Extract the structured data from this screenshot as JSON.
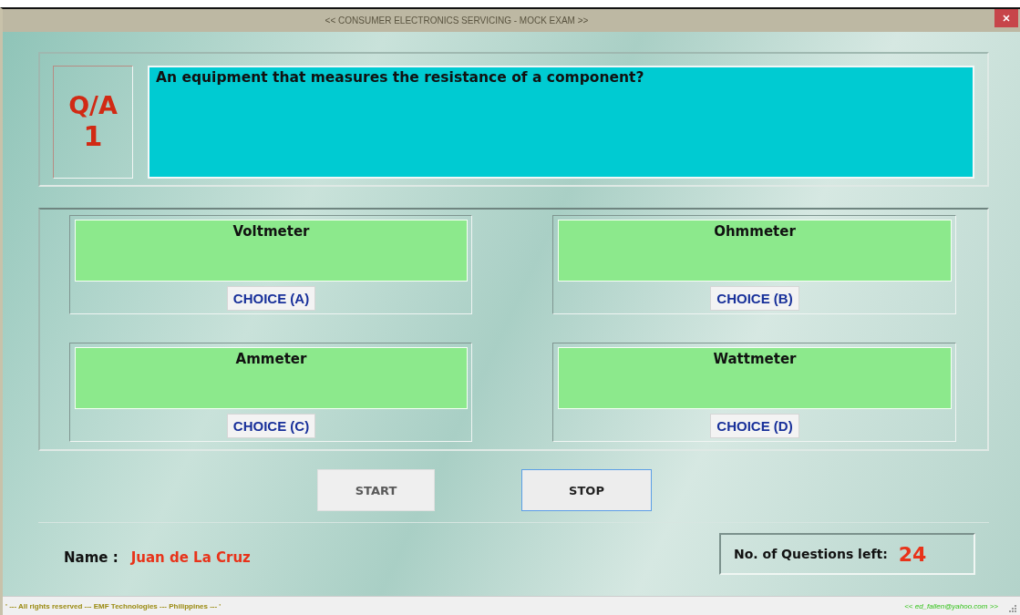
{
  "window": {
    "title": "<< CONSUMER ELECTRONICS SERVICING - MOCK EXAM >>"
  },
  "question": {
    "label": "Q/A",
    "number": "1",
    "text": "An equipment that measures the resistance of a component?"
  },
  "choices": [
    {
      "answer": "Voltmeter",
      "button": "CHOICE (A)"
    },
    {
      "answer": "Ohmmeter",
      "button": "CHOICE (B)"
    },
    {
      "answer": "Ammeter",
      "button": "CHOICE (C)"
    },
    {
      "answer": "Wattmeter",
      "button": "CHOICE (D)"
    }
  ],
  "buttons": [
    {
      "label": "START",
      "disabled": true,
      "focused": false
    },
    {
      "label": "STOP",
      "disabled": false,
      "focused": true
    }
  ],
  "name": {
    "label": "Name :",
    "value": "Juan de La Cruz"
  },
  "remaining": {
    "label": "No. of Questions left:",
    "value": "24"
  },
  "status_bar": {
    "left": "' --- All rights reserved --- EMF Technologies --- Philippines --- '",
    "right": "<< ed_fallen@yahoo.com >>"
  }
}
